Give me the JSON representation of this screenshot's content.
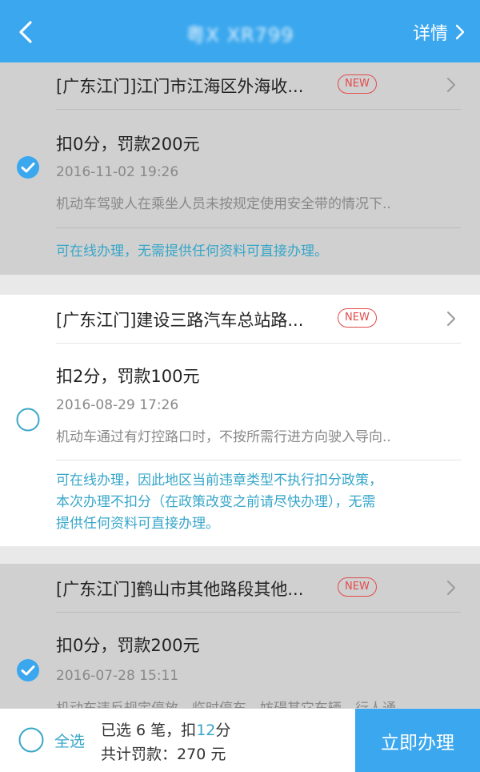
{
  "header": {
    "plate": "粤X XR799",
    "detail_label": "详情"
  },
  "violations": [
    {
      "title": "[广东江门]江门市江海区外海收...",
      "badge": "NEW",
      "score_fine": "扣0分，罚款200元",
      "time": "2016-11-02 19:26",
      "description": "机动车驾驶人在乘坐人员未按规定使用安全带的情况下..",
      "note": "可在线办理，无需提供任何资料可直接办理。",
      "selected": true
    },
    {
      "title": "[广东江门]建设三路汽车总站路...",
      "badge": "NEW",
      "score_fine": "扣2分，罚款100元",
      "time": "2016-08-29 17:26",
      "description": "机动车通过有灯控路口时，不按所需行进方向驶入导向..",
      "note_lines": [
        "可在线办理，因此地区当前违章类型不执行扣分政策，",
        "本次办理不扣分（在政策改变之前请尽快办理），无需",
        "提供任何资料可直接办理。"
      ],
      "selected": false
    },
    {
      "title": "[广东江门]鹤山市其他路段其他...",
      "badge": "NEW",
      "score_fine": "扣0分，罚款200元",
      "time": "2016-07-28 15:11",
      "description": "机动车违反规定停放、临时停车，妨碍其它车辆、行人通",
      "selected": true
    }
  ],
  "footer": {
    "select_all_label": "全选",
    "selected_prefix": "已选 ",
    "selected_count": "6",
    "selected_middle": " 笔，扣",
    "points": "12",
    "points_unit": "分",
    "total_label": "共计罚款：",
    "total_amount": "270",
    "total_unit": " 元",
    "action_label": "立即办理"
  },
  "colors": {
    "primary": "#3aa7ee",
    "accent_text": "#36a6c9",
    "badge_red": "#e24a4a",
    "selected_bg": "#d0d0d0"
  }
}
